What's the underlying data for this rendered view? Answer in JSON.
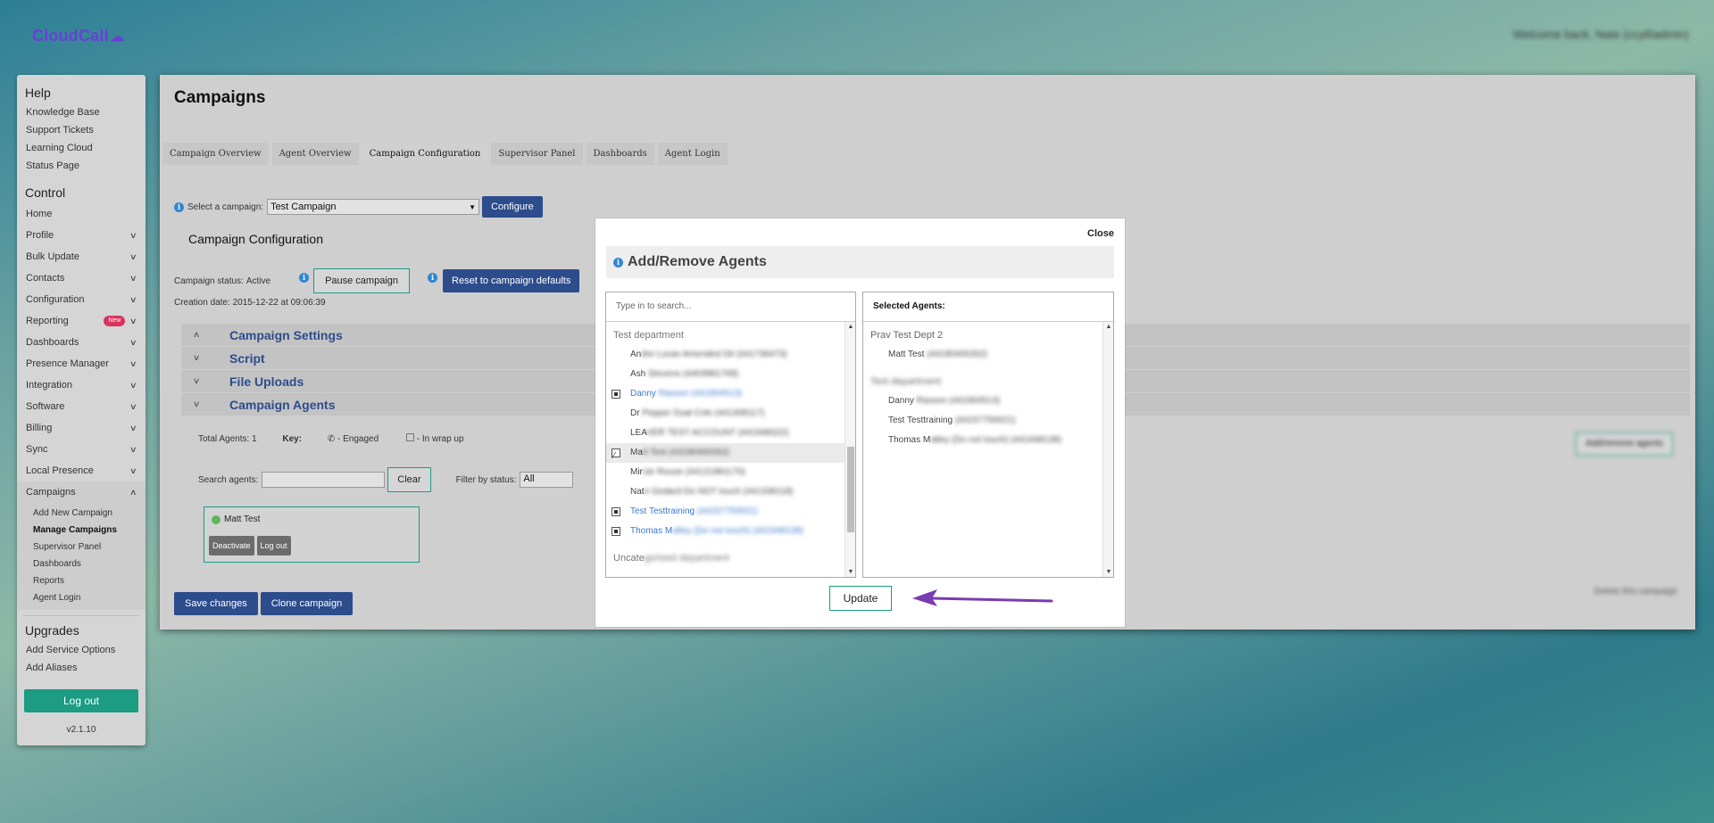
{
  "brand": {
    "name": "CloudCall"
  },
  "header": {
    "welcome": "Welcome back, Nate (ccyl0admin)"
  },
  "sidebar": {
    "help_heading": "Help",
    "help_links": [
      "Knowledge Base",
      "Support Tickets",
      "Learning Cloud",
      "Status Page"
    ],
    "control_heading": "Control",
    "home": "Home",
    "items": [
      "Profile",
      "Bulk Update",
      "Contacts",
      "Configuration",
      "Reporting",
      "Dashboards",
      "Presence Manager",
      "Integration",
      "Software",
      "Billing",
      "Sync",
      "Local Presence",
      "Campaigns"
    ],
    "new_badge": "New",
    "campaign_sub": [
      "Add New Campaign",
      "Manage Campaigns",
      "Supervisor Panel",
      "Dashboards",
      "Reports",
      "Agent Login"
    ],
    "upgrades_heading": "Upgrades",
    "upgrade_links": [
      "Add Service Options",
      "Add Aliases"
    ],
    "logout": "Log out",
    "version": "v2.1.10"
  },
  "main": {
    "title": "Campaigns",
    "tabs": [
      "Campaign Overview",
      "Agent Overview",
      "Campaign Configuration",
      "Supervisor Panel",
      "Dashboards",
      "Agent Login"
    ],
    "select_label": "Select a campaign:",
    "selected_campaign": "Test Campaign",
    "configure": "Configure",
    "config_title": "Campaign Configuration",
    "status_label": "Campaign status:",
    "status_value": "Active",
    "pause": "Pause campaign",
    "reset": "Reset to campaign defaults",
    "creation_label": "Creation date:",
    "creation_value": "2015-12-22 at 09:06:39",
    "accordion": [
      "Campaign Settings",
      "Script",
      "File Uploads",
      "Campaign Agents"
    ],
    "total_agents_label": "Total Agents:",
    "total_agents": "1",
    "key_label": "Key:",
    "key_engaged": "- Engaged",
    "key_wrap": "- In wrap up",
    "search_agents_label": "Search agents:",
    "clear": "Clear",
    "filter_label": "Filter by status:",
    "filter_value": "All",
    "agent_name": "Matt Test",
    "deactivate": "Deactivate",
    "agent_logout": "Log out",
    "add_remove": "Add/remove agents",
    "delete_campaign": "Delete this campaign",
    "save": "Save changes",
    "clone": "Clone campaign"
  },
  "modal": {
    "close": "Close",
    "title": "Add/Remove Agents",
    "search_placeholder": "Type in to search...",
    "selected_header": "Selected Agents:",
    "groups": [
      {
        "name": "Test department",
        "options": [
          {
            "prefix": "An",
            "rest": "dre Lucas Amended Dit (441736473)",
            "selected": false
          },
          {
            "prefix": "Ash",
            "rest": " Stevens (4403981769)",
            "selected": false
          },
          {
            "prefix": "Danny",
            "rest": " Rasson (441904513)",
            "selected": true
          },
          {
            "prefix": "Dr",
            "rest": " Pepper Dual Cols (441308117)",
            "selected": false
          },
          {
            "prefix": "LEA",
            "rest": "VER TEST ACCOUNT (441948322)",
            "selected": false
          },
          {
            "prefix": "Ma",
            "rest": "tt Test (44190400262)",
            "selected": false
          },
          {
            "prefix": "Mir",
            "rest": "nie Rouse (44121981170)",
            "selected": false
          },
          {
            "prefix": "Nat",
            "rest": "e Gedard Do NOT touch (441338118)",
            "selected": false
          },
          {
            "prefix": "Test Testtraining",
            "rest": " (44157750021)",
            "selected": true
          },
          {
            "prefix": "Thomas M",
            "rest": "atley (Do not touch) (441948138)",
            "selected": true
          }
        ]
      },
      {
        "name": "Uncate",
        "name_rest": "gorised department"
      }
    ],
    "selected_groups": [
      {
        "name": "Prav Test Dept 2",
        "items": [
          {
            "prefix": "Matt Test",
            "rest": " (44190400262)"
          }
        ]
      },
      {
        "name": "Test department",
        "items": [
          {
            "prefix": "Danny",
            "rest": " Rasson (441904513)"
          },
          {
            "prefix": "Test Testtraining",
            "rest": " (44157750021)"
          },
          {
            "prefix": "Thomas M",
            "rest": "atley (Do not touch) (441948138)"
          }
        ]
      }
    ],
    "update": "Update"
  },
  "colors": {
    "accent_blue": "#2c4c8c",
    "accent_green": "#1b9c83",
    "arrow": "#7b3bb0",
    "brand": "#6a3fd9"
  }
}
